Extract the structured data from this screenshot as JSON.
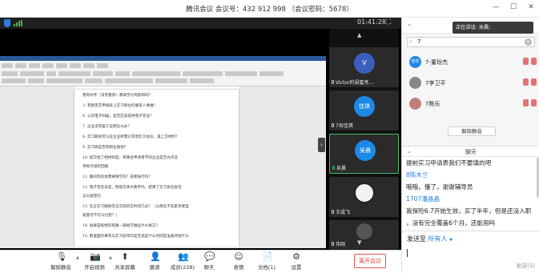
{
  "window": {
    "title": "腾讯会议 会议号：432 912 998  （会议密码：5678）",
    "controls": [
      "—",
      "☐",
      "✕"
    ]
  },
  "meeting": {
    "timer": "01:41:28"
  },
  "document": {
    "lines": [
      "我有补考（没有重修）那调学分有影响吗？",
      "3.    有暂定实申请表上实习单位的联系人填谁？",
      "6.    公司电子扫描，是否应该提供电子签证？",
      "7.    企业没有复工证明怎么办？",
      "8.    实习期间可以在企业所需订有暂实习协议，再上交材料？",
      "9.    实习岗是否有职业规划？",
      "10.    提交给了档材料后，有联合申请者不同企业是否允许这",
      "       项地子组织回报",
      "11.    期间有具体需要填写吗？成者按行吗？",
      "12.    电子签名去后，暂能实体大数字吗，结束了实习协议会签",
      "       怎么能定吗",
      "13.    在企实习确保无法交岗的实时间几号？（父母在不在家享便自",
      "       家量可不可以付登？）",
      "14.    如果是投档的有路一部给写做些什么样方？",
      "15.    那里面的事有与实习处年的是否说是什么时间是准备开始什么"
    ]
  },
  "tiles": [
    {
      "name": "Victor的闺蜜亮...",
      "initial": "V",
      "color": "#3c5fbf"
    },
    {
      "name": "7何佳琪",
      "initial": "佳琪",
      "color": "#1e88e5"
    },
    {
      "name": "吴晨",
      "initial": "吴晨",
      "color": "#1e88e5"
    },
    {
      "name": "王成飞",
      "initial": "",
      "color": "#f2f2f2"
    },
    {
      "name": "伟刚",
      "initial": "",
      "color": "#555555"
    }
  ],
  "toolbar": {
    "buttons": [
      {
        "label": "解除静音",
        "icon": "🎙"
      },
      {
        "label": "开启视频",
        "icon": "📷"
      },
      {
        "label": "共享屏幕",
        "icon": "⬆"
      },
      {
        "label": "邀请",
        "icon": "👤"
      },
      {
        "label": "成员(228)",
        "icon": "👥"
      },
      {
        "label": "聊天",
        "icon": "💬"
      },
      {
        "label": "表情",
        "icon": "☺"
      },
      {
        "label": "文档(1)",
        "icon": "📄"
      },
      {
        "label": "设置",
        "icon": "⚙"
      }
    ],
    "leave": "离开会议"
  },
  "members_panel": {
    "speaking": "正在讲话: 吴晨;",
    "search_value": "7",
    "members": [
      {
        "name": "7-董玢杰",
        "avatar_text": "玢杰",
        "color": "#1e88e5"
      },
      {
        "name": "7李卫平",
        "avatar_text": "",
        "color": "#888888"
      },
      {
        "name": "7陈乐",
        "avatar_text": "",
        "color": "#c0807a"
      }
    ],
    "unmute_all": "解除静音"
  },
  "chat": {
    "title": "聊天",
    "messages": [
      {
        "type": "text",
        "text": "提前实习申请表我们不要填的吧"
      },
      {
        "type": "sender",
        "text": "8陈木兰"
      },
      {
        "type": "text",
        "text": "哦哦，懂了，谢谢辅导员"
      },
      {
        "type": "sender",
        "text": "1707潘晶晶"
      },
      {
        "type": "text",
        "text": "我保险6.7开始生效，买了半年，但是还没入职"
      },
      {
        "type": "text",
        "text": "，没有完全覆盖6个月，还能用吗"
      }
    ],
    "send_to_label": "发送至",
    "send_to_target": "所有人",
    "send_button": "发送(S)"
  }
}
